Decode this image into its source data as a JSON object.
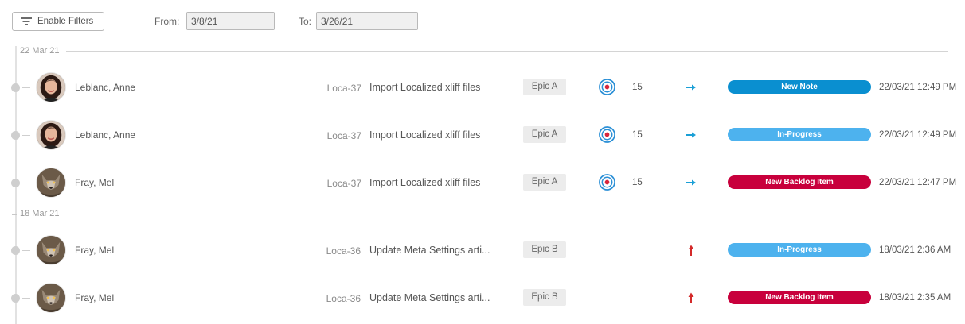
{
  "toolbar": {
    "filter_label": "Enable Filters",
    "from_label": "From:",
    "from_value": "3/8/21",
    "to_label": "To:",
    "to_value": "3/26/21"
  },
  "colors": {
    "new_note": "#0a8fd0",
    "in_progress": "#4db2ee",
    "new_backlog_item": "#c8003c",
    "arrow_right": "#1a9fd6",
    "arrow_up": "#d42a2a"
  },
  "groups": [
    {
      "date": "22 Mar 21",
      "rows": [
        {
          "name": "Leblanc, Anne",
          "avatar": "avatar-woman",
          "key": "Loca-37",
          "summary": "Import Localized xliff files",
          "epic": "Epic A",
          "has_target": true,
          "points": "15",
          "priority_icon": "arrow-right-icon",
          "status": "New Note",
          "status_color": "#0a8fd0",
          "timestamp": "22/03/21 12:49 PM"
        },
        {
          "name": "Leblanc, Anne",
          "avatar": "avatar-woman",
          "key": "Loca-37",
          "summary": "Import Localized xliff files",
          "epic": "Epic A",
          "has_target": true,
          "points": "15",
          "priority_icon": "arrow-right-icon",
          "status": "In-Progress",
          "status_color": "#4db2ee",
          "timestamp": "22/03/21 12:49 PM"
        },
        {
          "name": "Fray, Mel",
          "avatar": "avatar-wolf",
          "key": "Loca-37",
          "summary": "Import Localized xliff files",
          "epic": "Epic A",
          "has_target": true,
          "points": "15",
          "priority_icon": "arrow-right-icon",
          "status": "New Backlog Item",
          "status_color": "#c8003c",
          "timestamp": "22/03/21 12:47 PM"
        }
      ]
    },
    {
      "date": "18 Mar 21",
      "rows": [
        {
          "name": "Fray, Mel",
          "avatar": "avatar-wolf",
          "key": "Loca-36",
          "summary": "Update Meta Settings arti...",
          "epic": "Epic B",
          "has_target": false,
          "points": "",
          "priority_icon": "arrow-up-icon",
          "status": "In-Progress",
          "status_color": "#4db2ee",
          "timestamp": "18/03/21 2:36 AM"
        },
        {
          "name": "Fray, Mel",
          "avatar": "avatar-wolf",
          "key": "Loca-36",
          "summary": "Update Meta Settings arti...",
          "epic": "Epic B",
          "has_target": false,
          "points": "",
          "priority_icon": "arrow-up-icon",
          "status": "New Backlog Item",
          "status_color": "#c8003c",
          "timestamp": "18/03/21 2:35 AM"
        }
      ]
    }
  ]
}
